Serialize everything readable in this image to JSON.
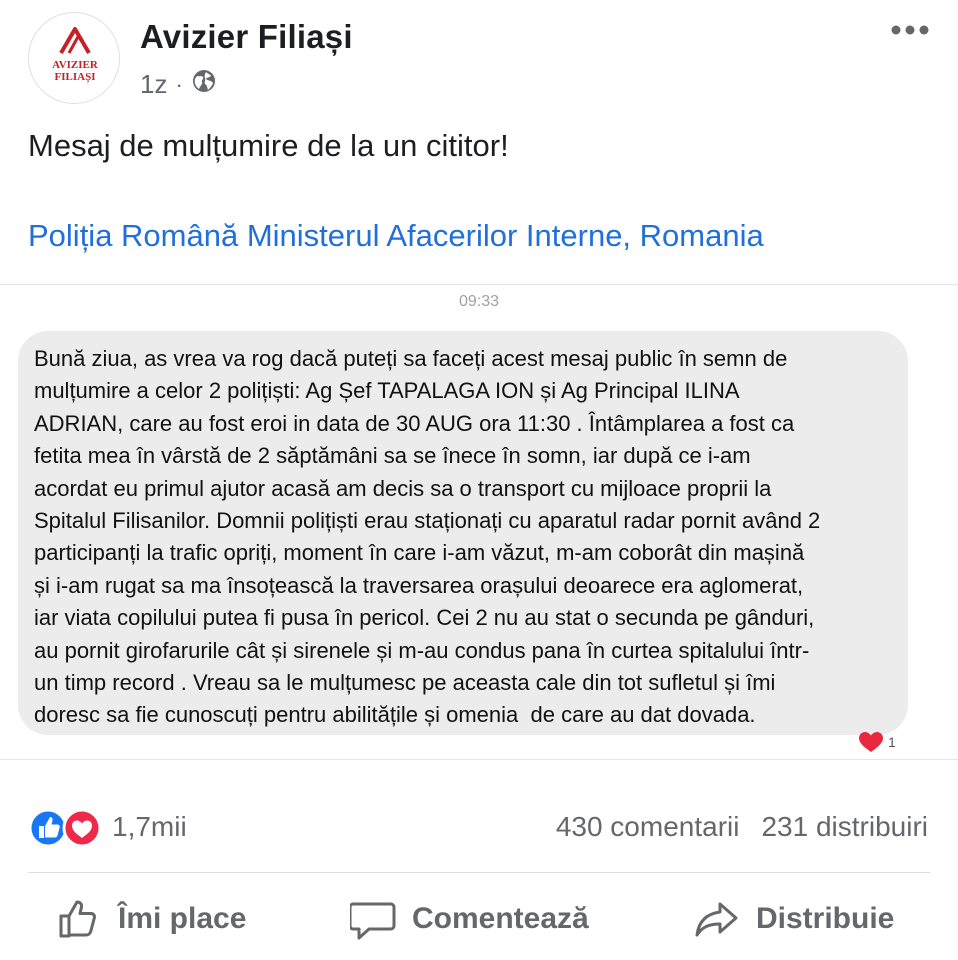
{
  "post": {
    "page_name": "Avizier Filiași",
    "logo_text_line1": "AVIZIER",
    "logo_text_line2": "FILIAȘI",
    "timestamp": "1z",
    "separator": "·",
    "privacy_icon": "globe-icon",
    "text": "Mesaj de mulțumire de la un cititor!",
    "tag_link": "Poliția Română Ministerul Afacerilor Interne, Romania"
  },
  "screenshot": {
    "time": "09:33",
    "message": "Bună ziua, as vrea va rog dacă puteți sa faceți acest mesaj public în semn de\nmulțumire a celor 2 polițiști: Ag Șef TAPALAGA ION și Ag Principal ILINA\nADRIAN, care au fost eroi in data de 30 AUG ora 11:30 . Întâmplarea a fost ca\nfetita mea în vârstă de 2 săptămâni sa se înece în somn, iar după ce i-am\nacordat eu primul ajutor acasă am decis sa o transport cu mijloace proprii la\nSpitalul Filisanilor. Domnii polițiști erau staționați cu aparatul radar pornit având 2\nparticipanți la trafic opriți, moment în care i-am văzut, m-am coborât din mașină\nși i-am rugat sa ma însoțească la traversarea orașului deoarece era aglomerat,\niar viata copilului putea fi pusa în pericol. Cei 2 nu au stat o secunda pe gânduri,\nau pornit girofarurile cât și sirenele și m-au condus pana în curtea spitalului într-\nun timp record . Vreau sa le mulțumesc pe aceasta cale din tot sufletul și îmi\ndoresc sa fie cunoscuți pentru abilitățile și omenia  de care au dat dovada.",
    "reaction_icon": "heart-icon",
    "reaction_count": "1"
  },
  "stats": {
    "reactions_total": "1,7mii",
    "comments": "430 comentarii",
    "shares": "231 distribuiri"
  },
  "actions": {
    "like": "Îmi place",
    "comment": "Comentează",
    "share": "Distribuie"
  },
  "colors": {
    "link": "#216fdb",
    "like_blue": "#1877f2",
    "love_red": "#f02849",
    "logo_red": "#c62026",
    "secondary_text": "#65676b"
  }
}
